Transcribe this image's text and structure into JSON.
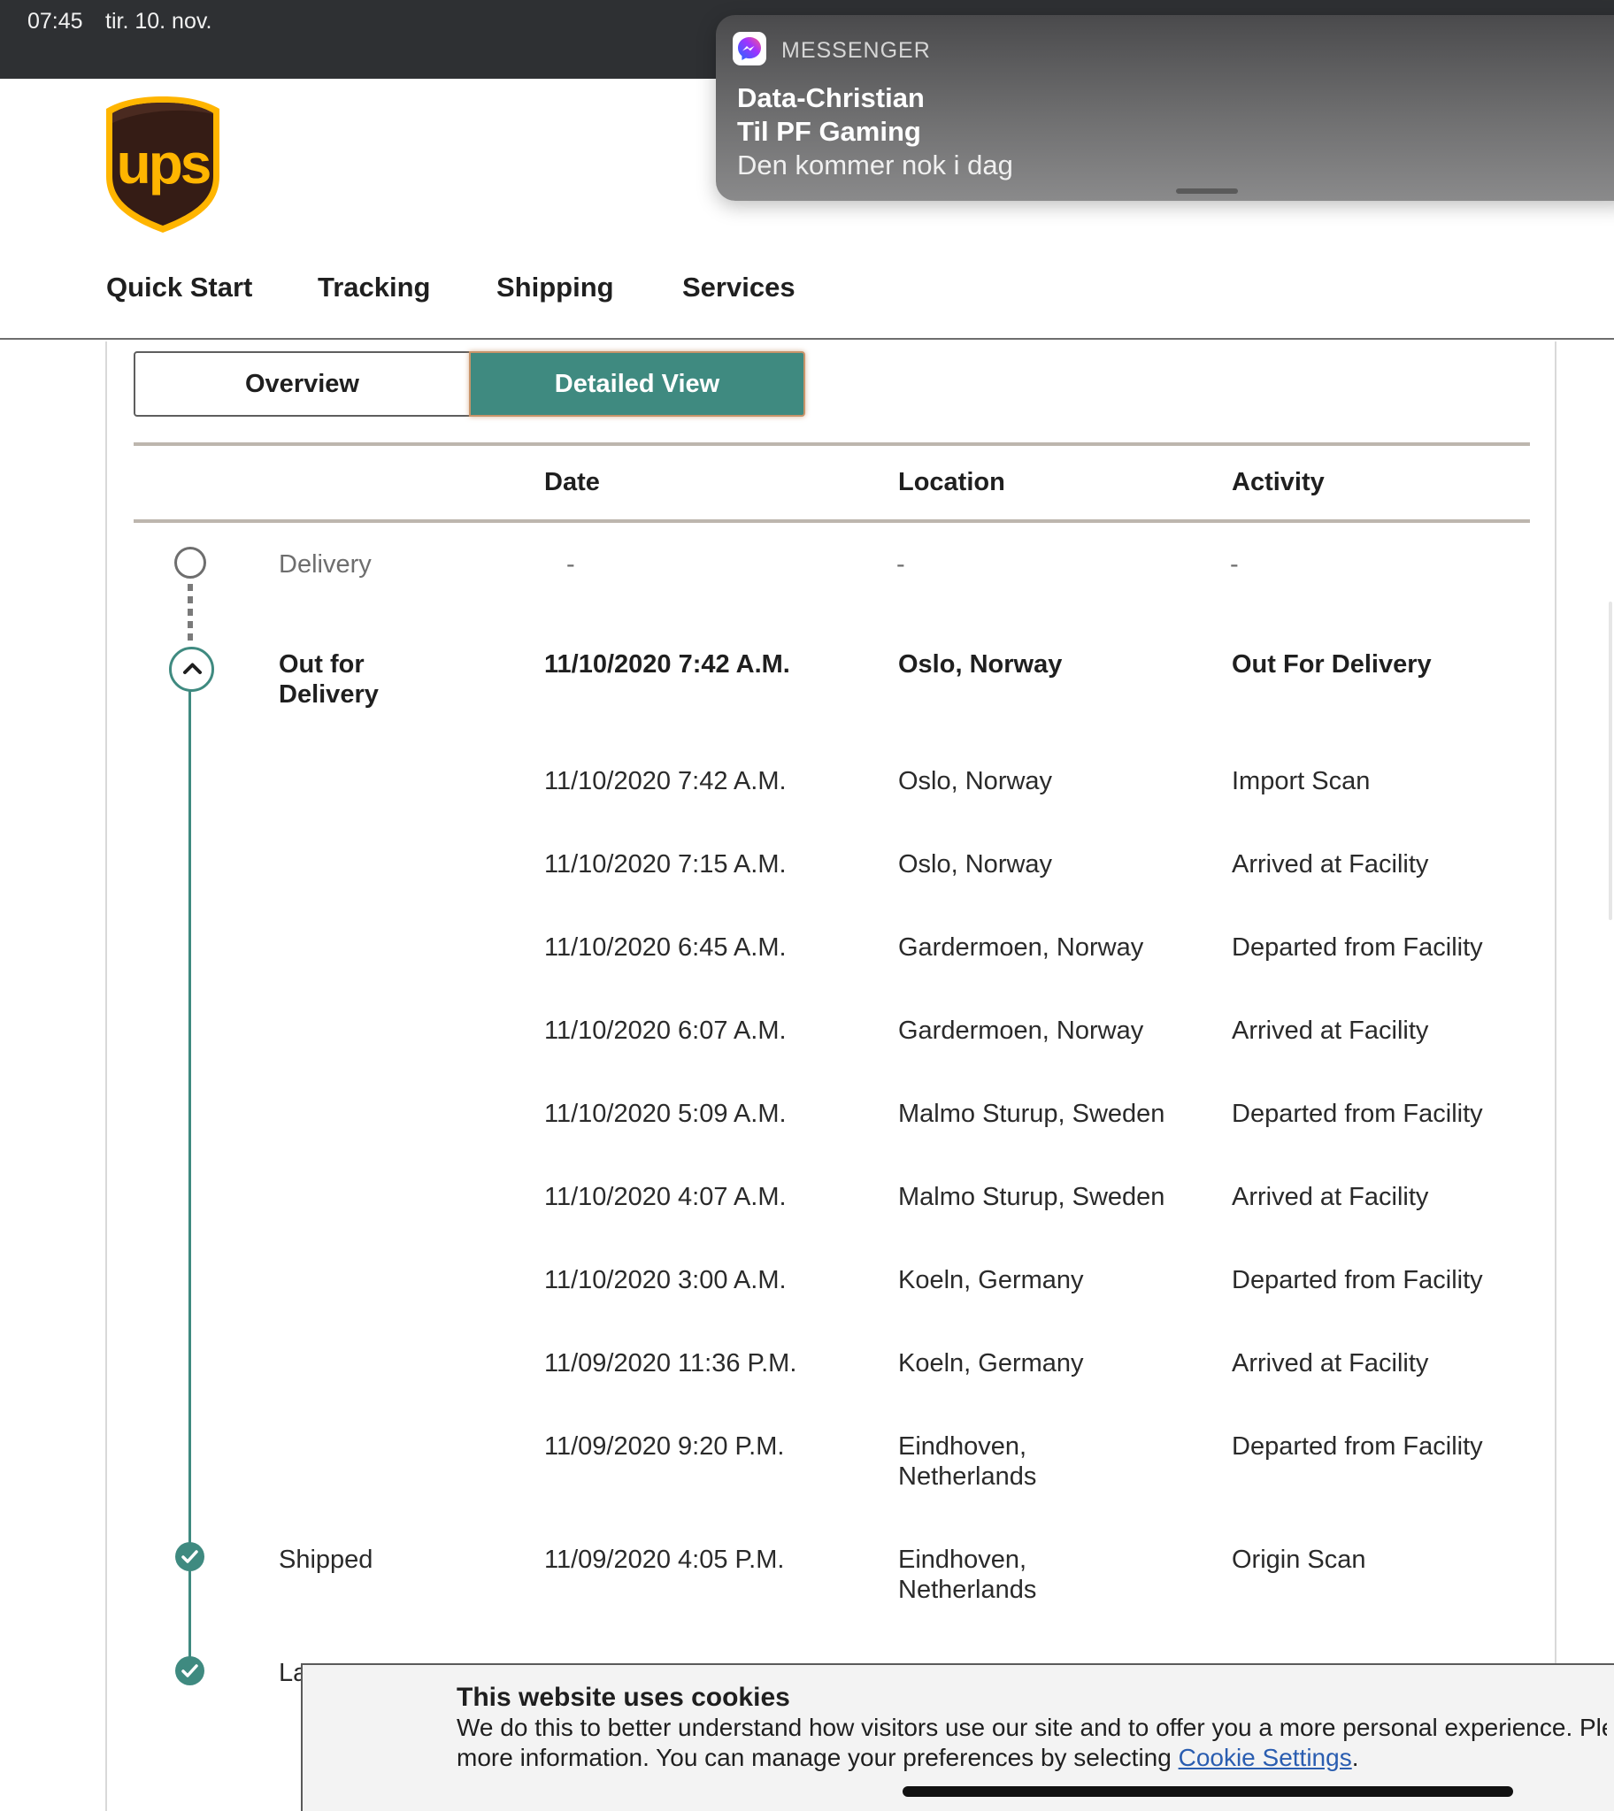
{
  "status_bar": {
    "time": "07:45",
    "date": "tir. 10. nov."
  },
  "notification": {
    "app_name": "MESSENGER",
    "sender": "Data-Christian",
    "group": "Til PF Gaming",
    "message": "Den kommer nok i dag",
    "icon": "messenger-icon"
  },
  "logo": {
    "text": "ups",
    "colors": {
      "shield": "#351c15",
      "gold": "#ffb500"
    }
  },
  "nav": [
    "Quick Start",
    "Tracking",
    "Shipping",
    "Services"
  ],
  "view_toggle": {
    "overview": "Overview",
    "detailed": "Detailed View",
    "selected": "Detailed View"
  },
  "table": {
    "headers": {
      "date": "Date",
      "location": "Location",
      "activity": "Activity"
    },
    "delivery_row": {
      "milestone": "Delivery",
      "date": "-",
      "location": "-",
      "activity": "-"
    },
    "current": {
      "milestone": "Out for Delivery",
      "date": "11/10/2020  7:42 A.M.",
      "location": "Oslo, Norway",
      "activity": "Out For Delivery"
    },
    "events": [
      {
        "date": "11/10/2020  7:42 A.M.",
        "location": "Oslo, Norway",
        "activity": "Import Scan"
      },
      {
        "date": "11/10/2020  7:15 A.M.",
        "location": "Oslo, Norway",
        "activity": "Arrived at Facility"
      },
      {
        "date": "11/10/2020  6:45 A.M.",
        "location": "Gardermoen, Norway",
        "activity": "Departed from Facility"
      },
      {
        "date": "11/10/2020  6:07 A.M.",
        "location": "Gardermoen, Norway",
        "activity": "Arrived at Facility"
      },
      {
        "date": "11/10/2020  5:09 A.M.",
        "location": "Malmo Sturup, Sweden",
        "activity": "Departed from Facility"
      },
      {
        "date": "11/10/2020  4:07 A.M.",
        "location": "Malmo Sturup, Sweden",
        "activity": "Arrived at Facility"
      },
      {
        "date": "11/10/2020  3:00 A.M.",
        "location": "Koeln, Germany",
        "activity": "Departed from Facility"
      },
      {
        "date": "11/09/2020  11:36 P.M.",
        "location": "Koeln, Germany",
        "activity": "Arrived at Facility"
      },
      {
        "date": "11/09/2020  9:20 P.M.",
        "location": "Eindhoven,",
        "location_line2": "Netherlands",
        "activity": "Departed from Facility"
      }
    ],
    "shipped": {
      "milestone": "Shipped",
      "date": "11/09/2020  4:05 P.M.",
      "location": "Eindhoven,",
      "location_line2": "Netherlands",
      "activity": "Origin Scan"
    },
    "label_row": {
      "milestone_partial": "La"
    }
  },
  "cookie_banner": {
    "title": "This website uses cookies",
    "text": "We do this to better understand how visitors use our site and to offer you a more personal experience. Ple",
    "text_line2": "more information. You can manage your preferences by selecting ",
    "link": "Cookie Settings",
    "suffix": "."
  },
  "colors": {
    "accent": "#3f8a80",
    "status_bar": "#2e3033",
    "rule": "#bdb6ae"
  }
}
